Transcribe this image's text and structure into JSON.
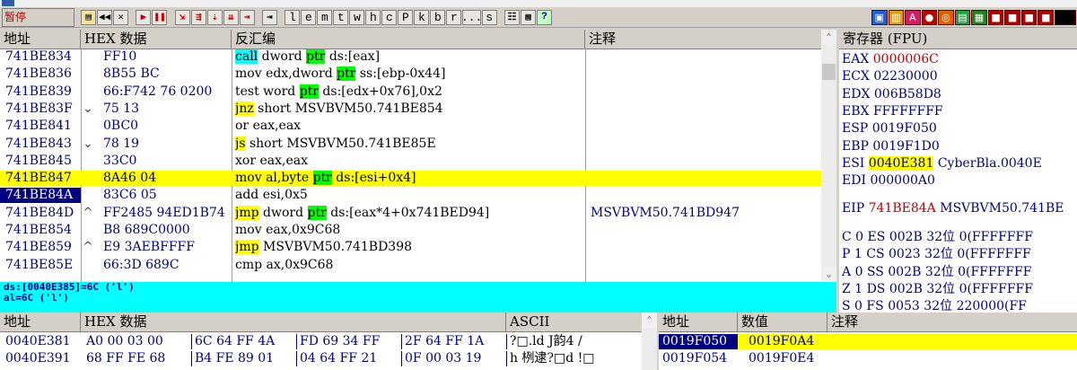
{
  "toolbar": {
    "status": "暂停",
    "buttons": [
      "l",
      "e",
      "m",
      "t",
      "w",
      "h",
      "c",
      "P",
      "k",
      "b",
      "r",
      "...",
      "s"
    ]
  },
  "colors": {
    "selection": "#000080",
    "highlight": "#ffff00",
    "keyword_call": "#00ffff",
    "keyword_jump": "#ffff00",
    "keyword_ptr": "#00ff00",
    "address": "#000080",
    "register_changed": "#c00000"
  },
  "disasm": {
    "headers": {
      "address": "地址",
      "hex": "HEX 数据",
      "disasm": "反汇编",
      "comment": "注释"
    },
    "rows": [
      {
        "addr": "741BE834",
        "mark": "",
        "hex": "FF10",
        "pre": "",
        "kw": "call",
        "kwc": "cyan",
        "mid": " dword ",
        "ptr": "ptr",
        "post": " ds:[eax]",
        "comment": ""
      },
      {
        "addr": "741BE836",
        "mark": "",
        "hex": "8B55 BC",
        "pre": "mov edx,dword ",
        "kw": "",
        "kwc": "",
        "mid": "",
        "ptr": "ptr",
        "post": " ss:[ebp-0x44]",
        "comment": ""
      },
      {
        "addr": "741BE839",
        "mark": "",
        "hex": "66:F742 76 0200",
        "pre": "test word ",
        "kw": "",
        "kwc": "",
        "mid": "",
        "ptr": "ptr",
        "post": " ds:[edx+0x76],0x2",
        "comment": ""
      },
      {
        "addr": "741BE83F",
        "mark": "⌄",
        "hex": "75 13",
        "pre": "",
        "kw": "jnz",
        "kwc": "yellow",
        "mid": " short MSVBVM50.741BE854",
        "ptr": "",
        "post": "",
        "comment": ""
      },
      {
        "addr": "741BE841",
        "mark": "",
        "hex": "0BC0",
        "pre": "or eax,eax",
        "kw": "",
        "kwc": "",
        "mid": "",
        "ptr": "",
        "post": "",
        "comment": ""
      },
      {
        "addr": "741BE843",
        "mark": "⌄",
        "hex": "78 19",
        "pre": "",
        "kw": "js",
        "kwc": "yellow",
        "mid": " short MSVBVM50.741BE85E",
        "ptr": "",
        "post": "",
        "comment": ""
      },
      {
        "addr": "741BE845",
        "mark": "",
        "hex": "33C0",
        "pre": "xor eax,eax",
        "kw": "",
        "kwc": "",
        "mid": "",
        "ptr": "",
        "post": "",
        "comment": ""
      },
      {
        "addr": "741BE847",
        "mark": "",
        "hex": "8A46 04",
        "pre": "mov al,byte ",
        "kw": "",
        "kwc": "",
        "mid": "",
        "ptr": "ptr",
        "post": " ds:[esi+0x4]",
        "comment": "",
        "highlight": true
      },
      {
        "addr": "741BE84A",
        "mark": "",
        "hex": "83C6 05",
        "pre": "add esi,0x5",
        "kw": "",
        "kwc": "",
        "mid": "",
        "ptr": "",
        "post": "",
        "comment": "",
        "selected": true
      },
      {
        "addr": "741BE84D",
        "mark": "^",
        "hex": "FF2485 94ED1B74",
        "pre": "",
        "kw": "jmp",
        "kwc": "yellow",
        "mid": " dword ",
        "ptr": "ptr",
        "post": " ds:[eax*4+0x741BED94]",
        "comment": "MSVBVM50.741BD947"
      },
      {
        "addr": "741BE854",
        "mark": "",
        "hex": "B8 689C0000",
        "pre": "mov eax,0x9C68",
        "kw": "",
        "kwc": "",
        "mid": "",
        "ptr": "",
        "post": "",
        "comment": ""
      },
      {
        "addr": "741BE859",
        "mark": "^",
        "hex": "E9 3AEBFFFF",
        "pre": "",
        "kw": "jmp",
        "kwc": "yellow",
        "mid": " MSVBVM50.741BD398",
        "ptr": "",
        "post": "",
        "comment": ""
      },
      {
        "addr": "741BE85E",
        "mark": "",
        "hex": "66:3D 689C",
        "pre": "cmp ax,0x9C68",
        "kw": "",
        "kwc": "",
        "mid": "",
        "ptr": "",
        "post": "",
        "comment": ""
      }
    ]
  },
  "info": {
    "line1": "ds:[0040E385]=6C ('l')",
    "line2": "al=6C ('l')"
  },
  "registers": {
    "header": "寄存器 (FPU)",
    "gp": [
      {
        "name": "EAX",
        "value": "0000006C",
        "changed": true,
        "extra": ""
      },
      {
        "name": "ECX",
        "value": "02230000",
        "changed": false,
        "extra": ""
      },
      {
        "name": "EDX",
        "value": "006B58D8",
        "changed": false,
        "extra": ""
      },
      {
        "name": "EBX",
        "value": "FFFFFFFF",
        "changed": false,
        "extra": ""
      },
      {
        "name": "ESP",
        "value": "0019F050",
        "changed": false,
        "extra": ""
      },
      {
        "name": "EBP",
        "value": "0019F1D0",
        "changed": false,
        "extra": ""
      },
      {
        "name": "ESI",
        "value": "0040E381",
        "changed": false,
        "extra": "CyberBla.0040E",
        "highlight": true
      },
      {
        "name": "EDI",
        "value": "000000A0",
        "changed": false,
        "extra": ""
      }
    ],
    "eip": {
      "name": "EIP",
      "value": "741BE84A",
      "extra": "MSVBVM50.741BE"
    },
    "flags": [
      {
        "f": "C",
        "v": "0",
        "seg": "ES",
        "sel": "002B",
        "bits": "32位",
        "base": "0(FFFFFFF"
      },
      {
        "f": "P",
        "v": "1",
        "seg": "CS",
        "sel": "0023",
        "bits": "32位",
        "base": "0(FFFFFFF"
      },
      {
        "f": "A",
        "v": "0",
        "seg": "SS",
        "sel": "002B",
        "bits": "32位",
        "base": "0(FFFFFFF"
      },
      {
        "f": "Z",
        "v": "1",
        "seg": "DS",
        "sel": "002B",
        "bits": "32位",
        "base": "0(FFFFFFF"
      },
      {
        "f": "S",
        "v": "0",
        "seg": "FS",
        "sel": "0053",
        "bits": "32位",
        "base": "220000(FF"
      }
    ]
  },
  "dump": {
    "headers": {
      "address": "地址",
      "hex": "HEX 数据",
      "ascii": "ASCII"
    },
    "rows": [
      {
        "addr": "0040E381",
        "b1": "A0 00 03 00",
        "b2": "6C 64 FF 4A",
        "b3": "FD 69 34 FF",
        "b4": "2F 64 FF 1A",
        "ascii": "?□.ld  J韵4  /",
        "sel": true
      },
      {
        "addr": "0040E391",
        "b1": "68 FF FE 68",
        "b2": "B4 FE 89 01",
        "b3": "04 64 FF 21",
        "b4": "0F 00 03 19",
        "ascii": "h  栵逮?□d  !□",
        "sel": false
      }
    ]
  },
  "stack": {
    "headers": {
      "address": "地址",
      "value": "数值",
      "comment": "注释"
    },
    "rows": [
      {
        "addr": "0019F050",
        "value": "0019F0A4",
        "comment": "",
        "selected": true
      },
      {
        "addr": "0019F054",
        "value": "0019F0E4",
        "comment": ""
      }
    ]
  }
}
